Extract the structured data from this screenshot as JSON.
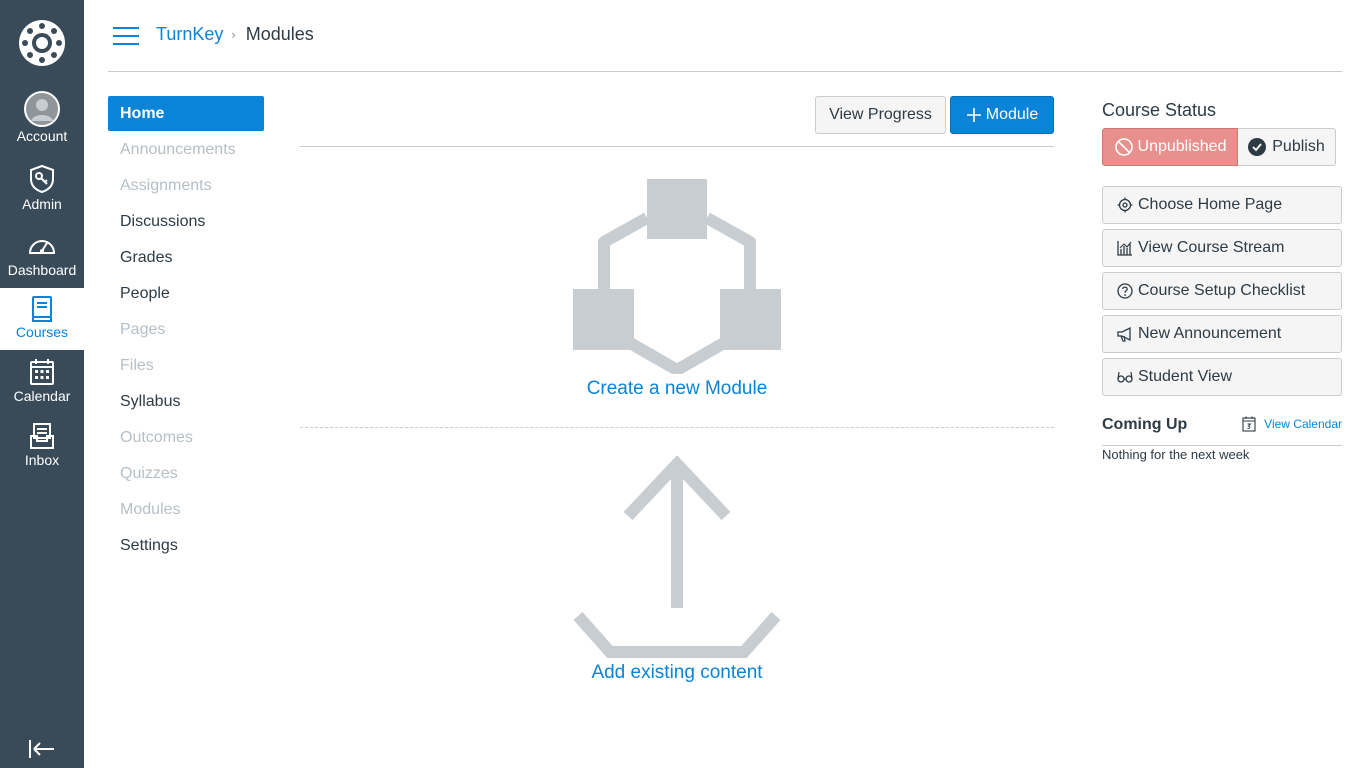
{
  "global_nav": {
    "items": [
      {
        "label": "Account",
        "icon": "account-avatar-icon"
      },
      {
        "label": "Admin",
        "icon": "admin-shield-icon"
      },
      {
        "label": "Dashboard",
        "icon": "dashboard-speedometer-icon"
      },
      {
        "label": "Courses",
        "icon": "courses-book-icon",
        "active": true
      },
      {
        "label": "Calendar",
        "icon": "calendar-icon"
      },
      {
        "label": "Inbox",
        "icon": "inbox-icon"
      }
    ],
    "collapse_icon": "collapse-nav-icon"
  },
  "breadcrumb": {
    "course": "TurnKey",
    "separator": "›",
    "current": "Modules"
  },
  "course_nav": {
    "items": [
      {
        "label": "Home",
        "state": "active"
      },
      {
        "label": "Announcements",
        "state": "disabled"
      },
      {
        "label": "Assignments",
        "state": "disabled"
      },
      {
        "label": "Discussions",
        "state": "enabled"
      },
      {
        "label": "Grades",
        "state": "enabled"
      },
      {
        "label": "People",
        "state": "enabled"
      },
      {
        "label": "Pages",
        "state": "disabled"
      },
      {
        "label": "Files",
        "state": "disabled"
      },
      {
        "label": "Syllabus",
        "state": "enabled"
      },
      {
        "label": "Outcomes",
        "state": "disabled"
      },
      {
        "label": "Quizzes",
        "state": "disabled"
      },
      {
        "label": "Modules",
        "state": "disabled"
      },
      {
        "label": "Settings",
        "state": "enabled"
      }
    ]
  },
  "main": {
    "view_progress_label": "View Progress",
    "add_module_label": "Module",
    "create_module_link": "Create a new Module",
    "add_existing_link": "Add existing content"
  },
  "sidebar": {
    "course_status_title": "Course Status",
    "unpublished_label": "Unpublished",
    "publish_label": "Publish",
    "actions": [
      {
        "label": "Choose Home Page",
        "icon": "home-page-gear-icon"
      },
      {
        "label": "View Course Stream",
        "icon": "course-stream-chart-icon"
      },
      {
        "label": "Course Setup Checklist",
        "icon": "question-circle-icon"
      },
      {
        "label": "New Announcement",
        "icon": "megaphone-icon"
      },
      {
        "label": "Student View",
        "icon": "glasses-icon"
      }
    ],
    "coming_up_title": "Coming Up",
    "view_calendar_label": "View Calendar",
    "nothing_text": "Nothing for the next week"
  },
  "colors": {
    "nav_bg": "#394b58",
    "brand_blue": "#0a84d8",
    "unpublished_bg": "#e8908d",
    "illustration_gray": "#c7cdd1"
  }
}
